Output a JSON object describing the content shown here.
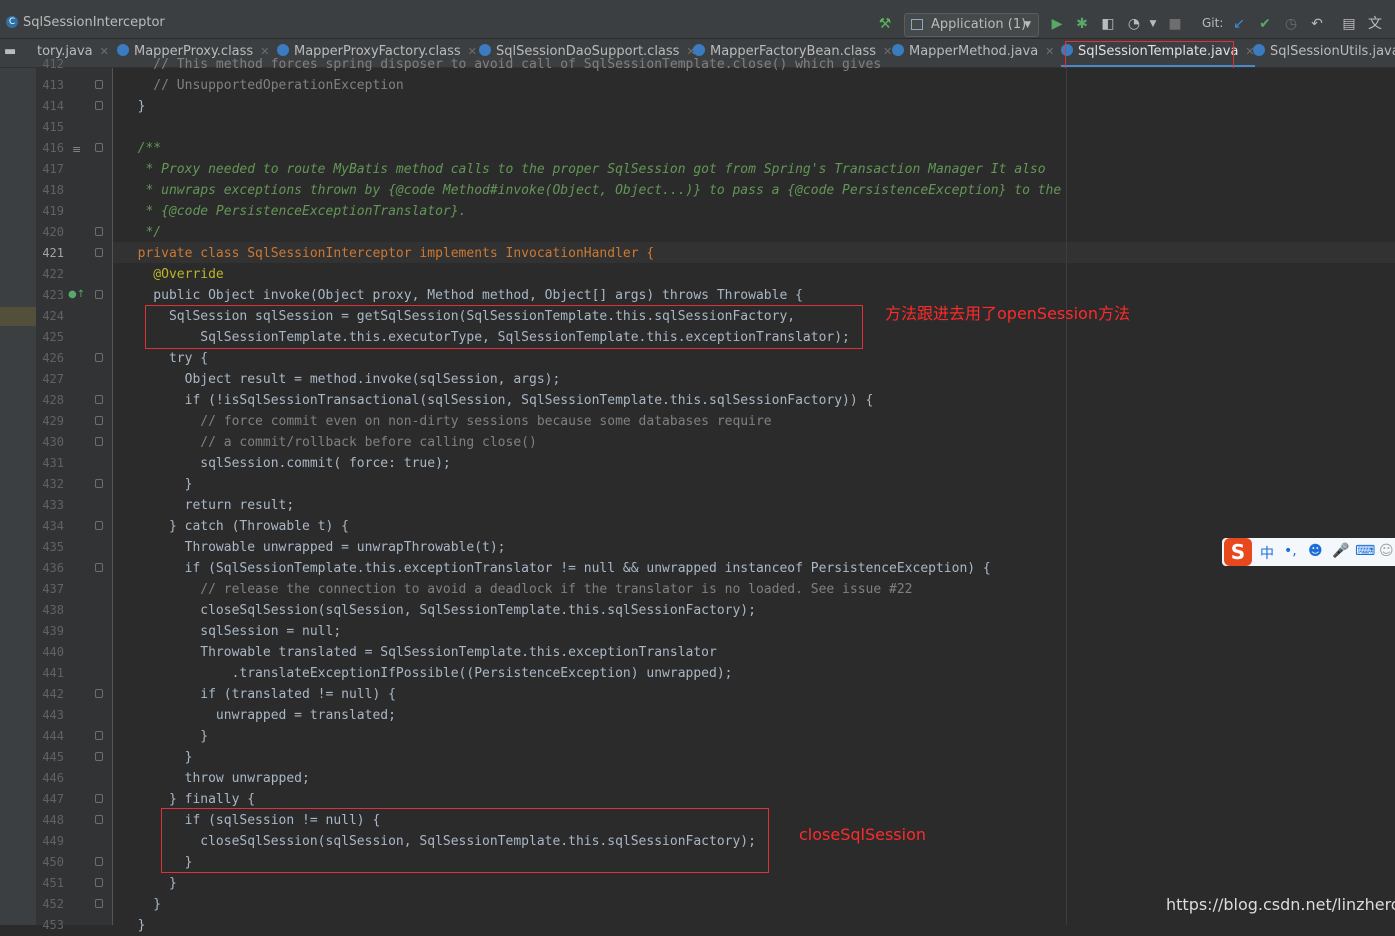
{
  "titlebar": {
    "title": "SqlSessionInterceptor",
    "run_config": "Application (1)",
    "git_label": "Git:"
  },
  "tabs": [
    {
      "label": "tory.java"
    },
    {
      "label": "MapperProxy.class"
    },
    {
      "label": "MapperProxyFactory.class"
    },
    {
      "label": "SqlSessionDaoSupport.class"
    },
    {
      "label": "MapperFactoryBean.class"
    },
    {
      "label": "MapperMethod.java"
    },
    {
      "label": "SqlSessionTemplate.java",
      "active": true
    },
    {
      "label": "SqlSessionUtils.java"
    }
  ],
  "code": {
    "current_line": "421",
    "lines": [
      {
        "n": "412",
        "text": "    // This method forces spring disposer to avoid call of SqlSessionTemplate.close() which gives"
      },
      {
        "n": "413",
        "text": "    // UnsupportedOperationException"
      },
      {
        "n": "414",
        "text": "  }"
      },
      {
        "n": "415",
        "text": ""
      },
      {
        "n": "416",
        "text": "  /**"
      },
      {
        "n": "417",
        "text": "   * Proxy needed to route MyBatis method calls to the proper SqlSession got from Spring's Transaction Manager It also"
      },
      {
        "n": "418",
        "text": "   * unwraps exceptions thrown by {@code Method#invoke(Object, Object...)} to pass a {@code PersistenceException} to the"
      },
      {
        "n": "419",
        "text": "   * {@code PersistenceExceptionTranslator}."
      },
      {
        "n": "420",
        "text": "   */"
      },
      {
        "n": "421",
        "text": "  private class SqlSessionInterceptor implements InvocationHandler {"
      },
      {
        "n": "422",
        "text": "    @Override"
      },
      {
        "n": "423",
        "text": "    public Object invoke(Object proxy, Method method, Object[] args) throws Throwable {"
      },
      {
        "n": "424",
        "text": "      SqlSession sqlSession = getSqlSession(SqlSessionTemplate.this.sqlSessionFactory,"
      },
      {
        "n": "425",
        "text": "          SqlSessionTemplate.this.executorType, SqlSessionTemplate.this.exceptionTranslator);"
      },
      {
        "n": "426",
        "text": "      try {"
      },
      {
        "n": "427",
        "text": "        Object result = method.invoke(sqlSession, args);"
      },
      {
        "n": "428",
        "text": "        if (!isSqlSessionTransactional(sqlSession, SqlSessionTemplate.this.sqlSessionFactory)) {"
      },
      {
        "n": "429",
        "text": "          // force commit even on non-dirty sessions because some databases require"
      },
      {
        "n": "430",
        "text": "          // a commit/rollback before calling close()"
      },
      {
        "n": "431",
        "text": "          sqlSession.commit( force: true);"
      },
      {
        "n": "432",
        "text": "        }"
      },
      {
        "n": "433",
        "text": "        return result;"
      },
      {
        "n": "434",
        "text": "      } catch (Throwable t) {"
      },
      {
        "n": "435",
        "text": "        Throwable unwrapped = unwrapThrowable(t);"
      },
      {
        "n": "436",
        "text": "        if (SqlSessionTemplate.this.exceptionTranslator != null && unwrapped instanceof PersistenceException) {"
      },
      {
        "n": "437",
        "text": "          // release the connection to avoid a deadlock if the translator is no loaded. See issue #22"
      },
      {
        "n": "438",
        "text": "          closeSqlSession(sqlSession, SqlSessionTemplate.this.sqlSessionFactory);"
      },
      {
        "n": "439",
        "text": "          sqlSession = null;"
      },
      {
        "n": "440",
        "text": "          Throwable translated = SqlSessionTemplate.this.exceptionTranslator"
      },
      {
        "n": "441",
        "text": "              .translateExceptionIfPossible((PersistenceException) unwrapped);"
      },
      {
        "n": "442",
        "text": "          if (translated != null) {"
      },
      {
        "n": "443",
        "text": "            unwrapped = translated;"
      },
      {
        "n": "444",
        "text": "          }"
      },
      {
        "n": "445",
        "text": "        }"
      },
      {
        "n": "446",
        "text": "        throw unwrapped;"
      },
      {
        "n": "447",
        "text": "      } finally {"
      },
      {
        "n": "448",
        "text": "        if (sqlSession != null) {"
      },
      {
        "n": "449",
        "text": "          closeSqlSession(sqlSession, SqlSessionTemplate.this.sqlSessionFactory);"
      },
      {
        "n": "450",
        "text": "        }"
      },
      {
        "n": "451",
        "text": "      }"
      },
      {
        "n": "452",
        "text": "    }"
      },
      {
        "n": "453",
        "text": "  }"
      }
    ]
  },
  "annotations": {
    "note_open_session": "方法跟进去用了openSession方法",
    "note_close_session": "closeSqlSession"
  },
  "ime_toolbar": {
    "logo": "S",
    "mode": "中",
    "punct": "•,"
  },
  "watermark": "https://blog.csdn.net/linzherong",
  "colors": {
    "editor_bg": "#2b2b2b",
    "keyword": "#cc7832",
    "field": "#9876aa",
    "method": "#ffc66d",
    "doc_comment": "#629755",
    "annotation_box": "#e0303a"
  }
}
